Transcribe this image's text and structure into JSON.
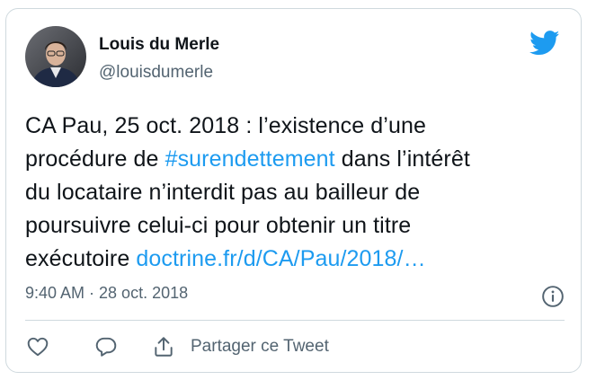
{
  "author": {
    "name": "Louis du Merle",
    "handle": "@louisdumerle",
    "avatar_icon": "profile-photo"
  },
  "brand": {
    "icon": "twitter-bird-icon",
    "color": "#1d9bf0"
  },
  "tweet": {
    "line1": "CA Pau, 25 oct. 2018 : l’existence d’une",
    "line2_before": "procédure de ",
    "hashtag": "#surendettement",
    "line2_after": " dans l’intérêt",
    "line3": "du locataire n’interdit pas au bailleur de",
    "line4": "poursuivre celui-ci pour obtenir un titre",
    "line5_before": "exécutoire ",
    "link": "doctrine.fr/d/CA/Pau/2018/…"
  },
  "meta": {
    "timestamp": "9:40 AM · 28 oct. 2018",
    "info_icon": "info-icon"
  },
  "actions": {
    "like_icon": "heart-icon",
    "reply_icon": "reply-icon",
    "share_icon": "share-icon",
    "share_label": "Partager ce Tweet"
  },
  "colors": {
    "text": "#0f1419",
    "secondary": "#536471",
    "link": "#1d9bf0",
    "border": "#cfd9de"
  }
}
